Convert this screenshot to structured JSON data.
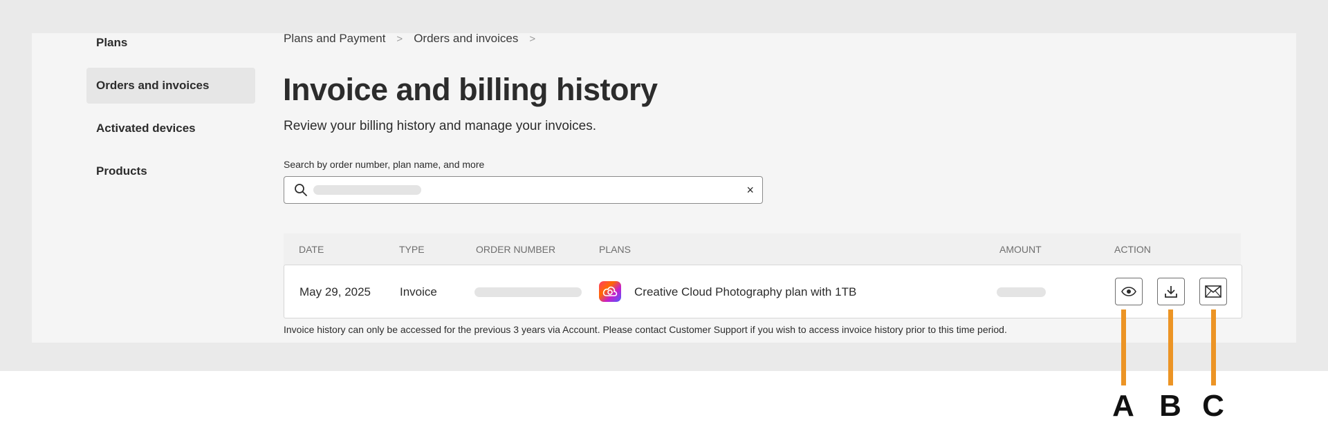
{
  "sidebar": {
    "items": [
      {
        "label": "Plans",
        "active": false
      },
      {
        "label": "Orders and invoices",
        "active": true
      },
      {
        "label": "Activated devices",
        "active": false
      },
      {
        "label": "Products",
        "active": false
      }
    ]
  },
  "breadcrumb": {
    "items": [
      "Plans and Payment",
      "Orders and invoices"
    ],
    "separator": ">"
  },
  "main": {
    "title": "Invoice and billing history",
    "subtitle": "Review your billing history and manage your invoices.",
    "search": {
      "label": "Search by order number, plan name, and more",
      "value": "",
      "clear_glyph": "×"
    }
  },
  "table": {
    "headers": [
      "DATE",
      "TYPE",
      "ORDER NUMBER",
      "PLANS",
      "AMOUNT",
      "ACTION"
    ],
    "rows": [
      {
        "date": "May 29, 2025",
        "type": "Invoice",
        "plan": "Creative Cloud Photography plan with 1TB",
        "actions": [
          "eye-icon",
          "download-icon",
          "mail-icon"
        ]
      }
    ]
  },
  "footnote": "Invoice history can only be accessed for the previous 3 years via Account. Please contact Customer Support if you wish to access invoice history prior to this time period.",
  "callouts": [
    "A",
    "B",
    "C"
  ],
  "colors": {
    "callout_line": "#ec9425",
    "page_band": "#eaeaea",
    "panel": "#f5f5f5"
  }
}
